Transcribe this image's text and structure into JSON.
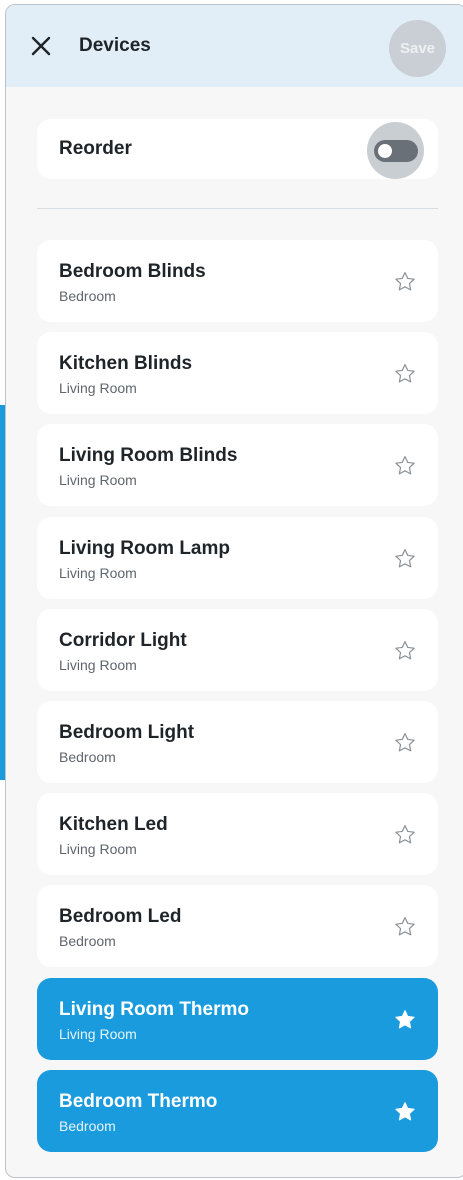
{
  "header": {
    "title": "Devices",
    "save_label": "Save"
  },
  "reorder": {
    "label": "Reorder",
    "enabled": false
  },
  "colors": {
    "accent": "#1a9bdd",
    "header_bg": "#e1eef7",
    "star_outline": "#8a9299"
  },
  "icons": {
    "close": "close-icon",
    "star_outline": "star-outline-icon",
    "star_filled": "star-filled-icon"
  },
  "devices": [
    {
      "name": "Bedroom Blinds",
      "room": "Bedroom",
      "favorite": false
    },
    {
      "name": "Kitchen Blinds",
      "room": "Living Room",
      "favorite": false
    },
    {
      "name": "Living Room Blinds",
      "room": "Living Room",
      "favorite": false
    },
    {
      "name": "Living Room Lamp",
      "room": "Living Room",
      "favorite": false
    },
    {
      "name": "Corridor Light",
      "room": "Living Room",
      "favorite": false
    },
    {
      "name": "Bedroom Light",
      "room": "Bedroom",
      "favorite": false
    },
    {
      "name": "Kitchen Led",
      "room": "Living Room",
      "favorite": false
    },
    {
      "name": "Bedroom Led",
      "room": "Bedroom",
      "favorite": false
    },
    {
      "name": "Living Room Thermo",
      "room": "Living Room",
      "favorite": true
    },
    {
      "name": "Bedroom Thermo",
      "room": "Bedroom",
      "favorite": true
    }
  ]
}
